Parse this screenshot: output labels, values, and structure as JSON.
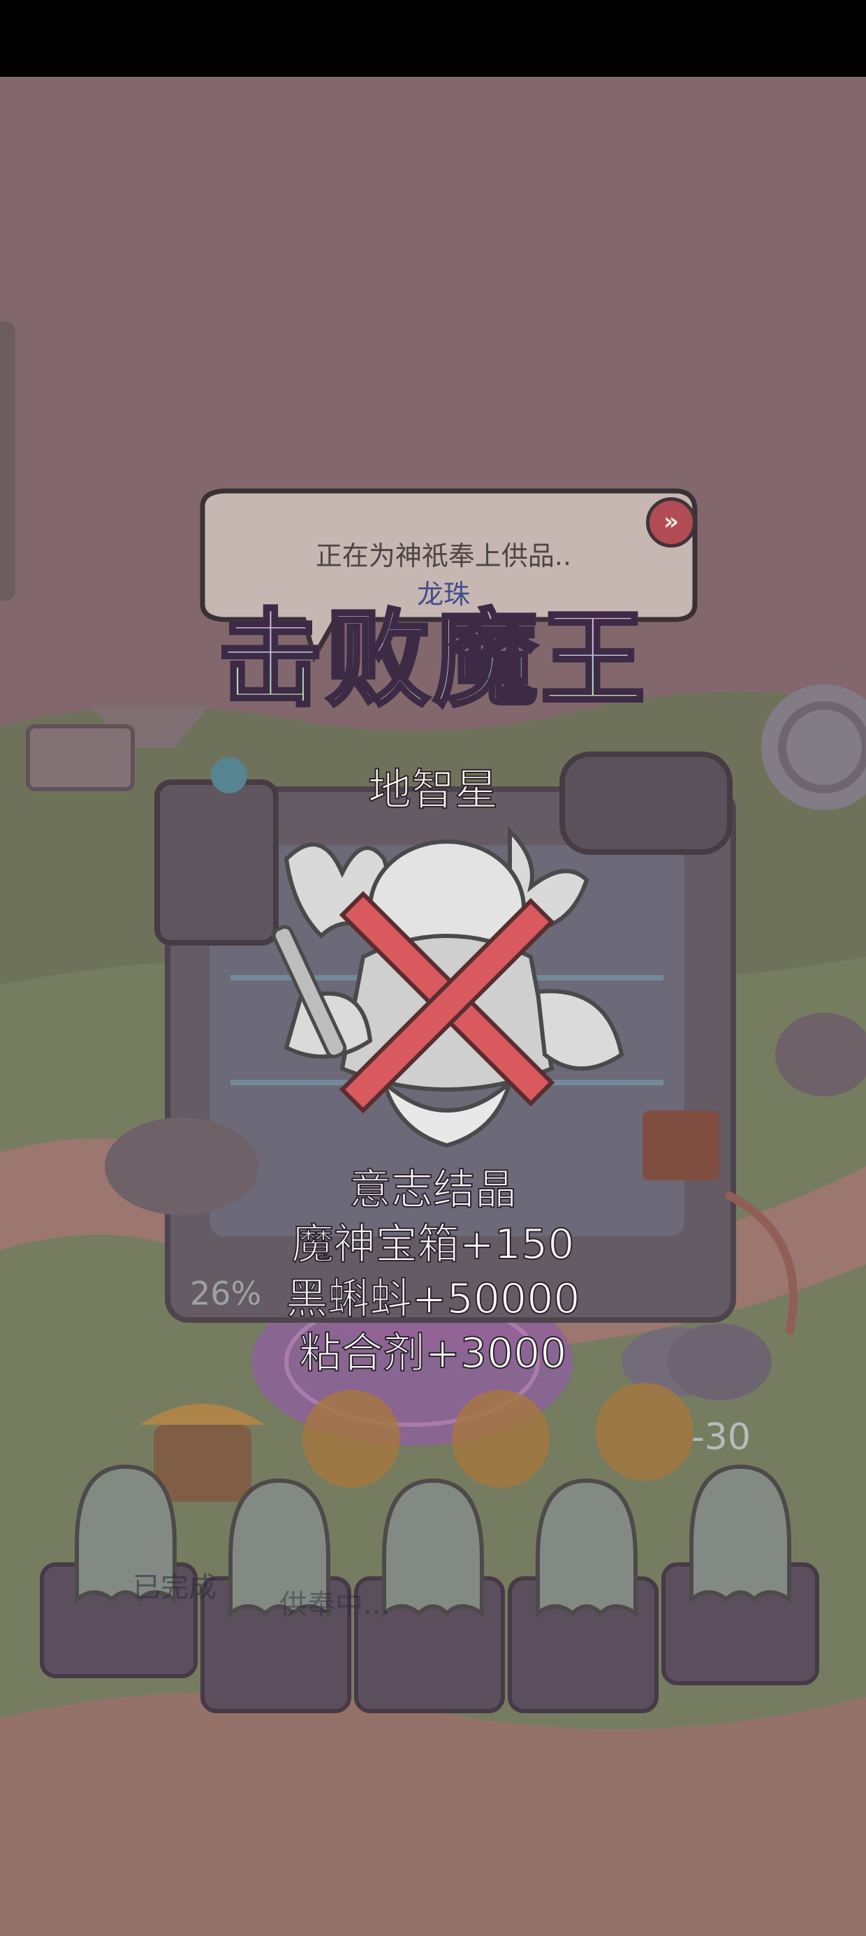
{
  "offering_dialog": {
    "title": "正在为神祇奉上供品..",
    "item": "龙珠",
    "skip_icon": "»"
  },
  "banner": {
    "text": "击败魔王"
  },
  "boss": {
    "name": "地智星",
    "status": "defeated"
  },
  "rewards": {
    "header": "意志结晶",
    "items": [
      "魔神宝箱+150",
      "黑蝌蚪+50000",
      "粘合剂+3000"
    ]
  },
  "background": {
    "progress_percent": "26%",
    "done_label": "已完成",
    "offering_label": "供奉中...",
    "damage_number": "-30"
  },
  "colors": {
    "banner_gradient": [
      "#f2b5c0",
      "#c8b4ea",
      "#a9dcc2",
      "#f0e2a6"
    ],
    "defeat_x": "#d85a5f",
    "skip_button": "#b24c54",
    "overlay": "#6e4b55"
  }
}
